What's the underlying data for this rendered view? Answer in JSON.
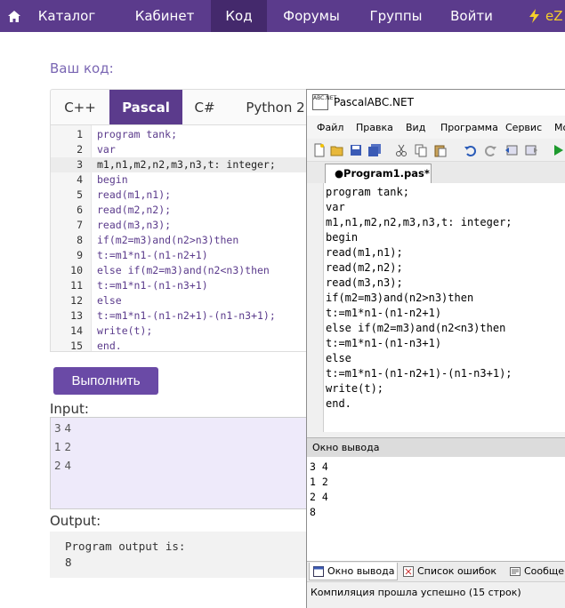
{
  "nav": {
    "items": [
      {
        "label": "Каталог"
      },
      {
        "label": "Кабинет"
      },
      {
        "label": "Код"
      },
      {
        "label": "Форумы"
      },
      {
        "label": "Группы"
      },
      {
        "label": "Войти"
      }
    ],
    "brand": "eZ",
    "active_color": "#44296c",
    "bar_color": "#5b3b8c"
  },
  "page": {
    "your_code_label": "Ваш код:",
    "lang_tabs": [
      {
        "label": "C++"
      },
      {
        "label": "Pascal"
      },
      {
        "label": "C#"
      },
      {
        "label": "Python 2"
      }
    ],
    "code_lines": [
      {
        "num": "1",
        "text": "program tank;"
      },
      {
        "num": "2",
        "text": "var"
      },
      {
        "num": "3",
        "text": "m1,n1,m2,n2,m3,n3,t: integer;"
      },
      {
        "num": "4",
        "text": "begin"
      },
      {
        "num": "5",
        "text": "read(m1,n1);"
      },
      {
        "num": "6",
        "text": "read(m2,n2);"
      },
      {
        "num": "7",
        "text": "read(m3,n3);"
      },
      {
        "num": "8",
        "text": "if(m2=m3)and(n2>n3)then"
      },
      {
        "num": "9",
        "text": "t:=m1*n1-(n1-n2+1)"
      },
      {
        "num": "10",
        "text": "else if(m2=m3)and(n2<n3)then"
      },
      {
        "num": "11",
        "text": "t:=m1*n1-(n1-n3+1)"
      },
      {
        "num": "12",
        "text": "else"
      },
      {
        "num": "13",
        "text": "t:=m1*n1-(n1-n2+1)-(n1-n3+1);"
      },
      {
        "num": "14",
        "text": "write(t);"
      },
      {
        "num": "15",
        "text": "end."
      }
    ],
    "run_label": "Выполнить",
    "input_label": "Input:",
    "input_lines": [
      "3 4",
      "1 2",
      "2 4"
    ],
    "output_label": "Output:",
    "output_lines": [
      "Program output is:",
      "8"
    ]
  },
  "ide": {
    "title": "PascalABC.NET",
    "logo_text": "ABC.NET",
    "menu": [
      "Файл",
      "Правка",
      "Вид",
      "Программа",
      "Сервис",
      "Мо"
    ],
    "toolbar_icons": [
      "new-file-icon",
      "open-folder-icon",
      "save-icon",
      "save-all-icon",
      "cut-icon",
      "copy-icon",
      "paste-icon",
      "undo-icon",
      "redo-icon",
      "back-icon",
      "forward-icon",
      "run-icon"
    ],
    "file_tab": "●Program1.pas*",
    "code_lines": [
      "program tank;",
      "var",
      "m1,n1,m2,n2,m3,n3,t: integer;",
      "begin",
      "read(m1,n1);",
      "read(m2,n2);",
      "read(m3,n3);",
      "if(m2=m3)and(n2>n3)then",
      "t:=m1*n1-(n1-n2+1)",
      "else if(m2=m3)and(n2<n3)then",
      "t:=m1*n1-(n1-n3+1)",
      "else",
      "t:=m1*n1-(n1-n2+1)-(n1-n3+1);",
      "write(t);",
      "end."
    ],
    "output_header": "Окно вывода",
    "output_lines": [
      "3 4",
      "1 2",
      "2 4",
      "8"
    ],
    "bottom_tabs": [
      {
        "label": "Окно вывода"
      },
      {
        "label": "Список ошибок"
      },
      {
        "label": "Сообще"
      }
    ],
    "status": "Компиляция прошла успешно (15 строк)"
  }
}
